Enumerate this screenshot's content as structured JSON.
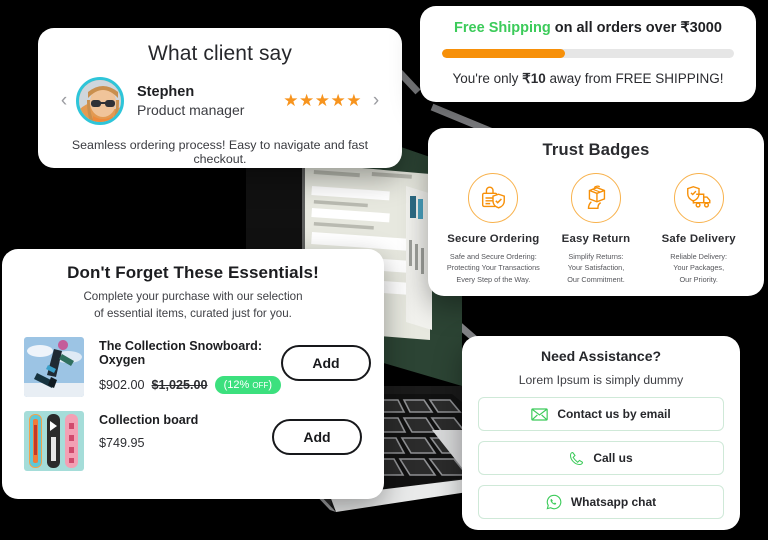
{
  "colors": {
    "background": "#000000",
    "card": "#ffffff",
    "accent_orange": "#f79009",
    "accent_green": "#3ccb5a",
    "badge_green": "#3ce07e",
    "star_orange": "#f7941e",
    "avatar_ring": "#2ec5d9",
    "laptop_screen": "#2c4434"
  },
  "testimonial": {
    "title": "What client say",
    "prev_label": "‹",
    "next_label": "›",
    "name": "Stephen",
    "role": "Product manager",
    "stars": "★★★★★",
    "rating": 5,
    "quote": "Seamless ordering process! Easy to navigate and fast checkout.",
    "avatar_icon": "user-avatar"
  },
  "shipping": {
    "headline_highlight": "Free Shipping",
    "headline_rest": " on all orders over ₹3000",
    "progress_percent": 42,
    "subtext_prefix": "You're only ",
    "subtext_amount": "₹10",
    "subtext_suffix": " away from FREE SHIPPING!"
  },
  "trust": {
    "title": "Trust Badges",
    "items": [
      {
        "icon": "lock-shield-icon",
        "name": "Secure Ordering",
        "desc": "Safe and Secure Ordering:\nProtecting Your Transactions\nEvery Step of the Way."
      },
      {
        "icon": "box-hand-return-icon",
        "name": "Easy Return",
        "desc": "Simplify Returns:\nYour Satisfaction,\nOur Commitment."
      },
      {
        "icon": "shield-truck-icon",
        "name": "Safe Delivery",
        "desc": "Reliable Delivery:\nYour Packages,\nOur Priority."
      }
    ]
  },
  "essentials": {
    "title": "Don't Forget These Essentials!",
    "subtitle": "Complete your purchase with our selection\nof essential items, curated just for you.",
    "products": [
      {
        "thumb_icon": "snowboarder-photo",
        "name": "The Collection Snowboard: Oxygen",
        "price": "$902.00",
        "compare_at_price": "$1,025.00",
        "discount_badge": "(12% ",
        "discount_badge_small": "OFF",
        "discount_badge_end": ")",
        "add_label": "Add"
      },
      {
        "thumb_icon": "three-snowboards-photo",
        "name": "Collection board",
        "price": "$749.95",
        "compare_at_price": "",
        "discount_badge": "",
        "add_label": "Add"
      }
    ]
  },
  "assistance": {
    "title": "Need Assistance?",
    "subtitle": "Lorem Ipsum is simply dummy",
    "options": [
      {
        "icon": "envelope-icon",
        "label": "Contact us by email"
      },
      {
        "icon": "phone-icon",
        "label": "Call us"
      },
      {
        "icon": "whatsapp-icon",
        "label": "Whatsapp chat"
      }
    ]
  }
}
